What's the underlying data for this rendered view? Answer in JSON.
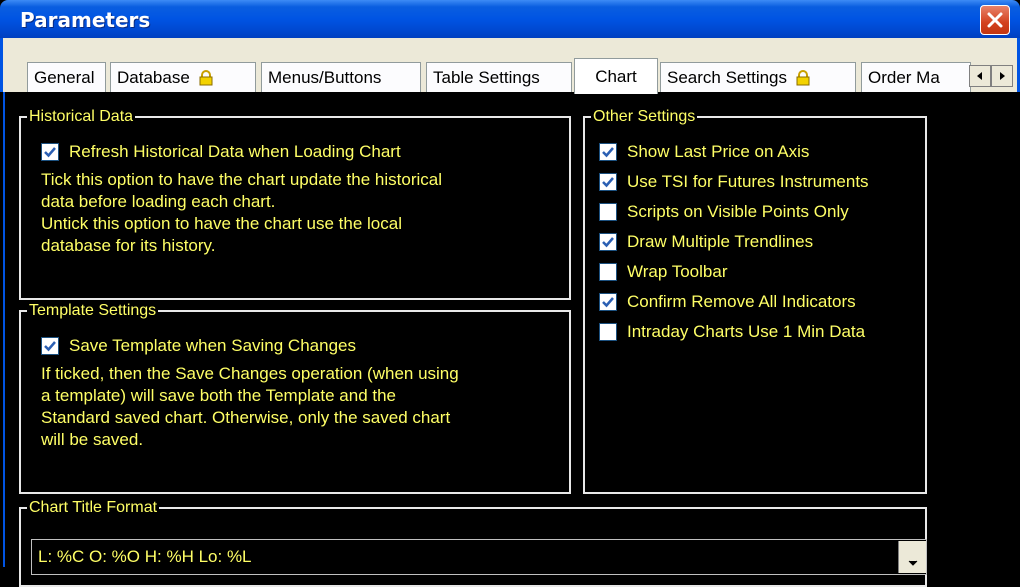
{
  "window": {
    "title": "Parameters",
    "close_icon": "close-icon"
  },
  "tabs": [
    {
      "label": "General",
      "locked": false
    },
    {
      "label": "Database",
      "locked": true
    },
    {
      "label": "Menus/Buttons",
      "locked": false
    },
    {
      "label": "Table Settings",
      "locked": false
    },
    {
      "label": "Chart",
      "locked": false,
      "active": true
    },
    {
      "label": "Search Settings",
      "locked": true
    },
    {
      "label": "Order Ma",
      "locked": false
    }
  ],
  "historical": {
    "title": "Historical Data",
    "checkbox_label": "Refresh Historical Data when Loading Chart",
    "checked": true,
    "description": "Tick this option to have the chart update the historical\ndata before loading each chart.\nUntick this option to have the chart use the local\ndatabase for its history."
  },
  "template": {
    "title": "Template Settings",
    "checkbox_label": "Save Template when Saving Changes",
    "checked": true,
    "description": "If ticked, then the Save Changes operation (when using\na template) will save both the Template and the\nStandard saved chart.  Otherwise, only the saved chart\nwill be saved."
  },
  "other": {
    "title": "Other Settings",
    "items": [
      {
        "label": "Show Last Price on Axis",
        "checked": true
      },
      {
        "label": "Use TSI for Futures Instruments",
        "checked": true
      },
      {
        "label": "Scripts on Visible Points Only",
        "checked": false
      },
      {
        "label": "Draw Multiple Trendlines",
        "checked": true
      },
      {
        "label": "Wrap Toolbar",
        "checked": false
      },
      {
        "label": "Confirm Remove All Indicators",
        "checked": true
      },
      {
        "label": "Intraday Charts Use 1 Min Data",
        "checked": false
      }
    ]
  },
  "title_format": {
    "title": "Chart Title Format",
    "value": "L: %C O: %O H: %H Lo: %L"
  },
  "colors": {
    "text": "#ffff66",
    "check": "#2b5fb3",
    "title_bar": "#0054e3"
  }
}
